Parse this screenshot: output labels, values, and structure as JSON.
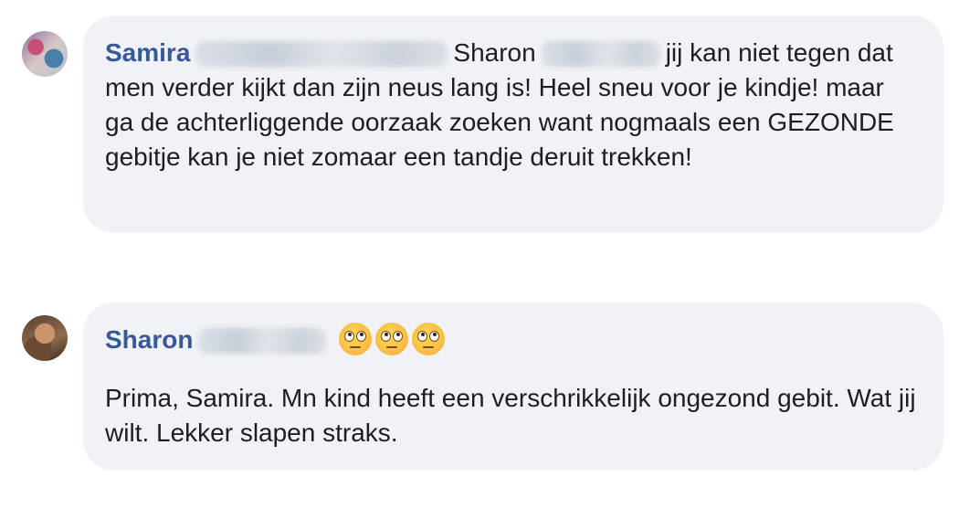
{
  "comments": [
    {
      "author": "Samira",
      "mention": "Sharon",
      "text_after_mention": "jij kan niet tegen dat men verder kijkt dan zijn neus lang is! Heel sneu voor je kindje! maar ga de achterliggende oorzaak zoeken want nogmaals een GEZONDE gebitje kan je niet zomaar een tandje deruit trekken!"
    },
    {
      "author": "Sharon",
      "emojis": [
        "face-with-rolling-eyes",
        "face-with-rolling-eyes",
        "face-with-rolling-eyes"
      ],
      "text": "Prima, Samira. Mn kind heeft een verschrikkelijk ongezond gebit. Wat jij wilt. Lekker slapen straks."
    }
  ],
  "colors": {
    "author_name": "#385898",
    "bubble_bg": "#f0f2f5",
    "text": "#1c1e21"
  }
}
